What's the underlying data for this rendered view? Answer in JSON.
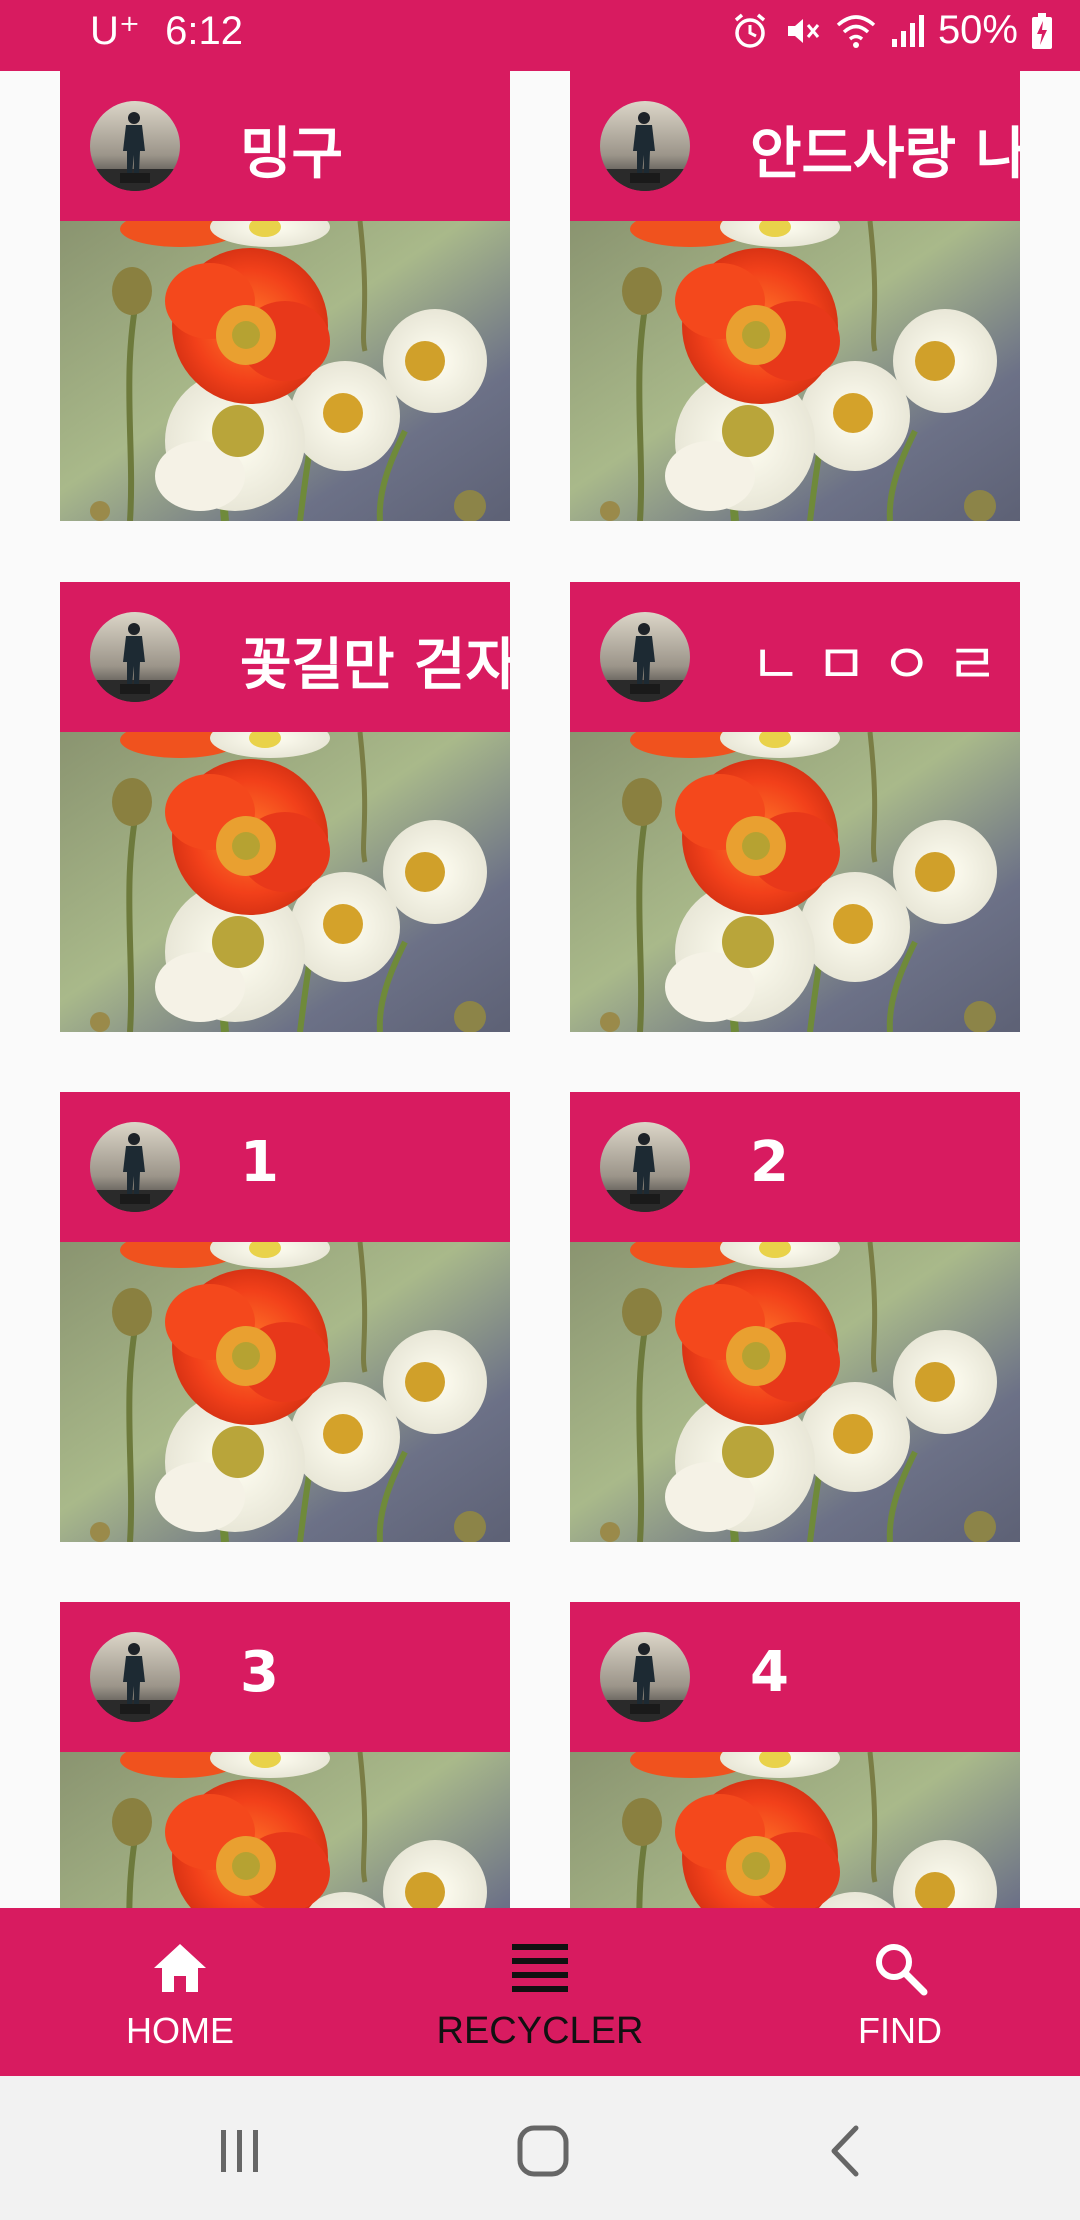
{
  "status_bar": {
    "carrier": "U⁺",
    "time": "6:12",
    "battery": "50%",
    "icons": [
      "alarm-icon",
      "mute-icon",
      "wifi-icon",
      "signal-icon",
      "battery-charging-icon"
    ]
  },
  "cards": [
    {
      "title": "밍구",
      "avatar": "person-silhouette",
      "image": "poppy-flowers-photo"
    },
    {
      "title": "안드사랑 나",
      "avatar": "person-silhouette",
      "image": "poppy-flowers-photo"
    },
    {
      "title": "꽃길만 걷자",
      "avatar": "person-silhouette",
      "image": "poppy-flowers-photo"
    },
    {
      "title": "ㄴㅁㅇㄹㄴ",
      "avatar": "person-silhouette",
      "image": "poppy-flowers-photo"
    },
    {
      "title": "1",
      "avatar": "person-silhouette",
      "image": "poppy-flowers-photo"
    },
    {
      "title": "2",
      "avatar": "person-silhouette",
      "image": "poppy-flowers-photo"
    },
    {
      "title": "3",
      "avatar": "person-silhouette",
      "image": "poppy-flowers-photo"
    },
    {
      "title": "4",
      "avatar": "person-silhouette",
      "image": "poppy-flowers-photo"
    }
  ],
  "bottom_nav": {
    "items": [
      {
        "label": "HOME",
        "icon": "home-icon",
        "active": false
      },
      {
        "label": "RECYCLER",
        "icon": "list-icon",
        "active": true
      },
      {
        "label": "FIND",
        "icon": "search-icon",
        "active": false
      }
    ]
  },
  "system_nav": {
    "icons": [
      "recents-icon",
      "home-button-icon",
      "back-icon"
    ]
  },
  "colors": {
    "accent": "#d81b60",
    "background": "#fafafa",
    "system_nav": "#f2f2f2"
  }
}
